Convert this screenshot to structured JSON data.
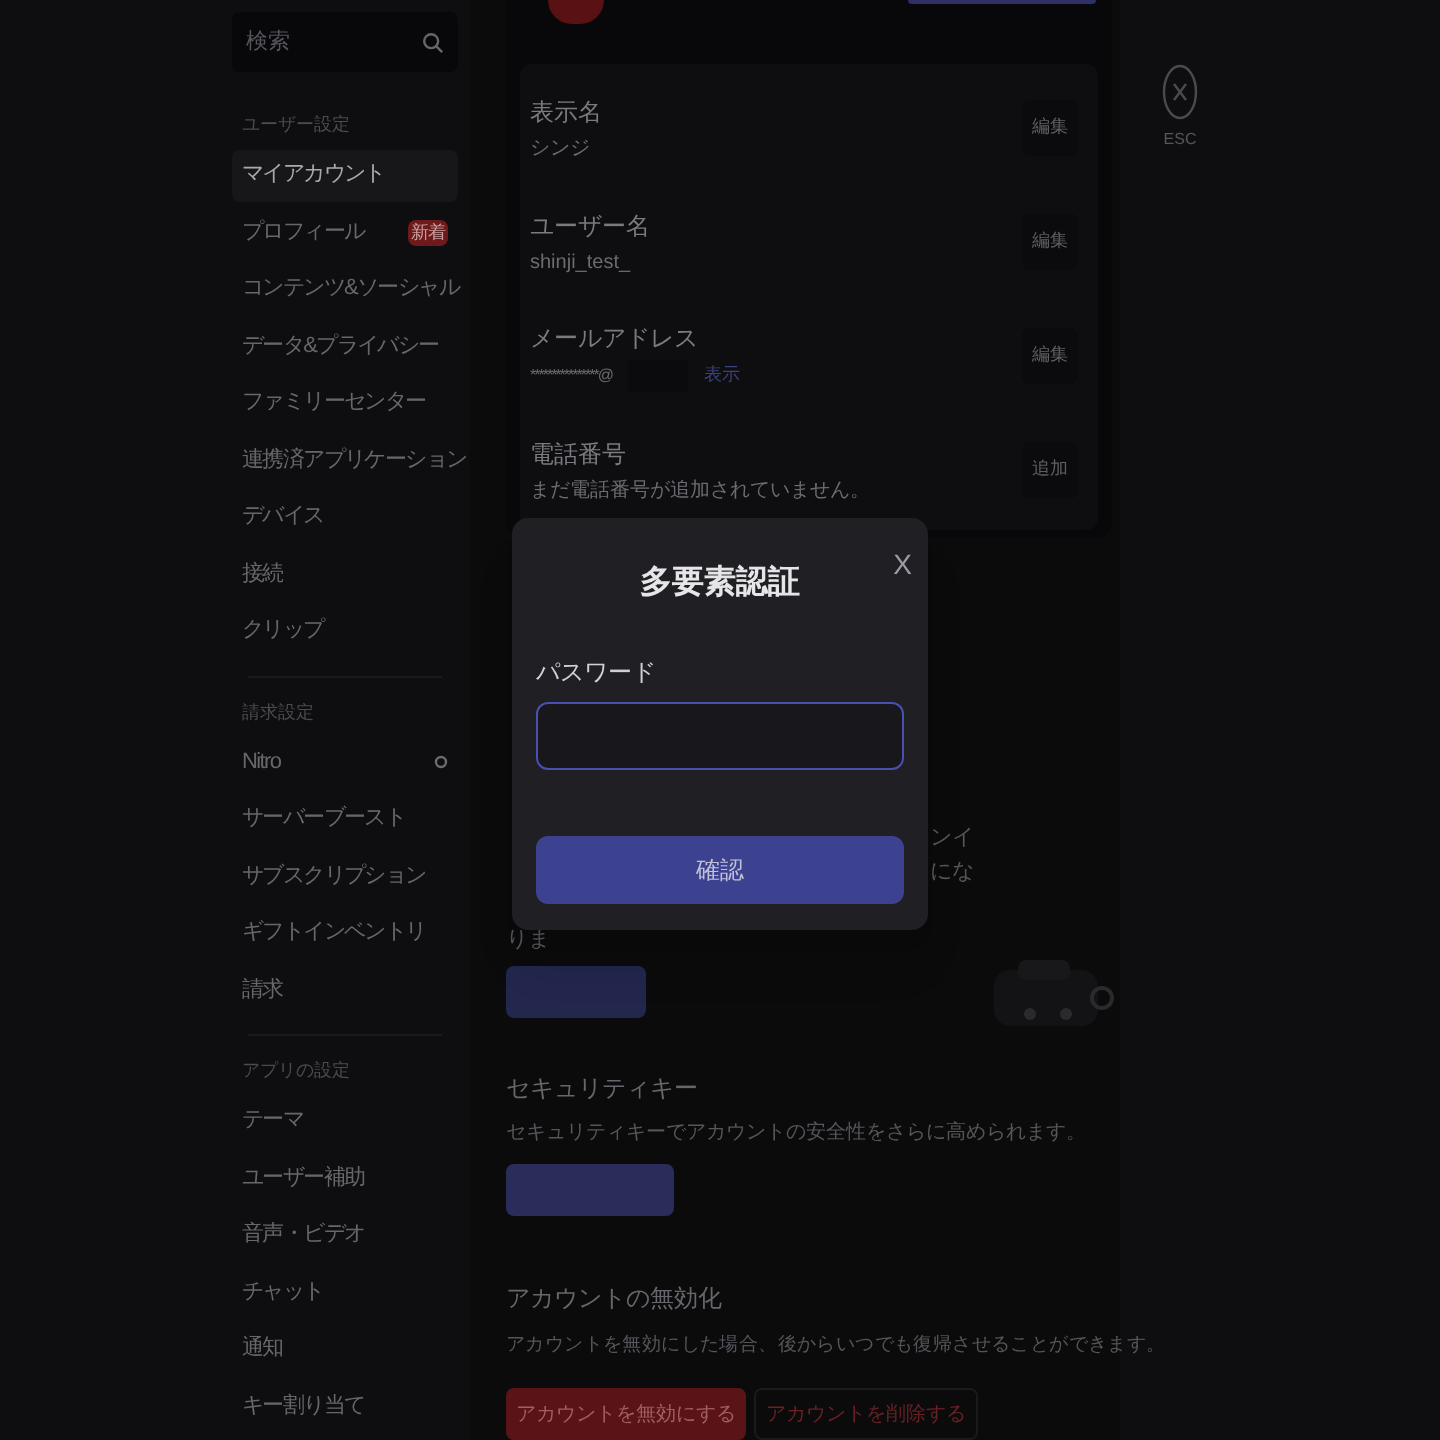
{
  "sidebar": {
    "search": {
      "placeholder": "検索"
    },
    "groups": [
      {
        "header": "ユーザー設定",
        "items": [
          {
            "label": "マイアカウント",
            "selected": true
          },
          {
            "label": "プロフィール",
            "selected": false,
            "badge": "新着"
          },
          {
            "label": "コンテンツ&ソーシャル",
            "selected": false
          },
          {
            "label": "データ&プライバシー",
            "selected": false
          },
          {
            "label": "ファミリーセンター",
            "selected": false
          },
          {
            "label": "連携済アプリケーション",
            "selected": false
          },
          {
            "label": "デバイス",
            "selected": false
          },
          {
            "label": "接続",
            "selected": false
          },
          {
            "label": "クリップ",
            "selected": false
          }
        ]
      },
      {
        "header": "請求設定",
        "items": [
          {
            "label": "Nitro",
            "selected": false,
            "icon": true
          },
          {
            "label": "サーバーブースト",
            "selected": false
          },
          {
            "label": "サブスクリプション",
            "selected": false
          },
          {
            "label": "ギフトインベントリ",
            "selected": false
          },
          {
            "label": "請求",
            "selected": false
          }
        ]
      },
      {
        "header": "アプリの設定",
        "items": [
          {
            "label": "テーマ",
            "selected": false
          },
          {
            "label": "ユーザー補助",
            "selected": false
          },
          {
            "label": "音声・ビデオ",
            "selected": false
          },
          {
            "label": "チャット",
            "selected": false
          },
          {
            "label": "通知",
            "selected": false
          },
          {
            "label": "キー割り当て",
            "selected": false
          }
        ]
      }
    ]
  },
  "account": {
    "fields": [
      {
        "label": "表示名",
        "value": "シンジ",
        "action": "編集"
      },
      {
        "label": "ユーザー名",
        "value": "shinji_test_",
        "action": "編集"
      },
      {
        "label": "メールアドレス",
        "value": "****************@",
        "reveal": "表示",
        "action": "編集"
      },
      {
        "label": "電話番号",
        "value": "まだ電話番号が追加されていません。",
        "action": "追加"
      }
    ]
  },
  "fragments": [
    "ンイ",
    "にな",
    "りま"
  ],
  "security_key": {
    "title": "セキュリティキー",
    "description": "セキュリティキーでアカウントの安全性をさらに高められます。"
  },
  "deactivation": {
    "title": "アカウントの無効化",
    "description": "アカウントを無効にした場合、後からいつでも復帰させることができます。",
    "buttons": [
      {
        "label": "アカウントを無効にする",
        "kind": "danger"
      },
      {
        "label": "アカウントを削除する",
        "kind": "outline"
      }
    ]
  },
  "close": {
    "label": "ESC"
  },
  "modal": {
    "title": "多要素認証",
    "close": "X",
    "field_label": "パスワード",
    "submit": "確認"
  }
}
